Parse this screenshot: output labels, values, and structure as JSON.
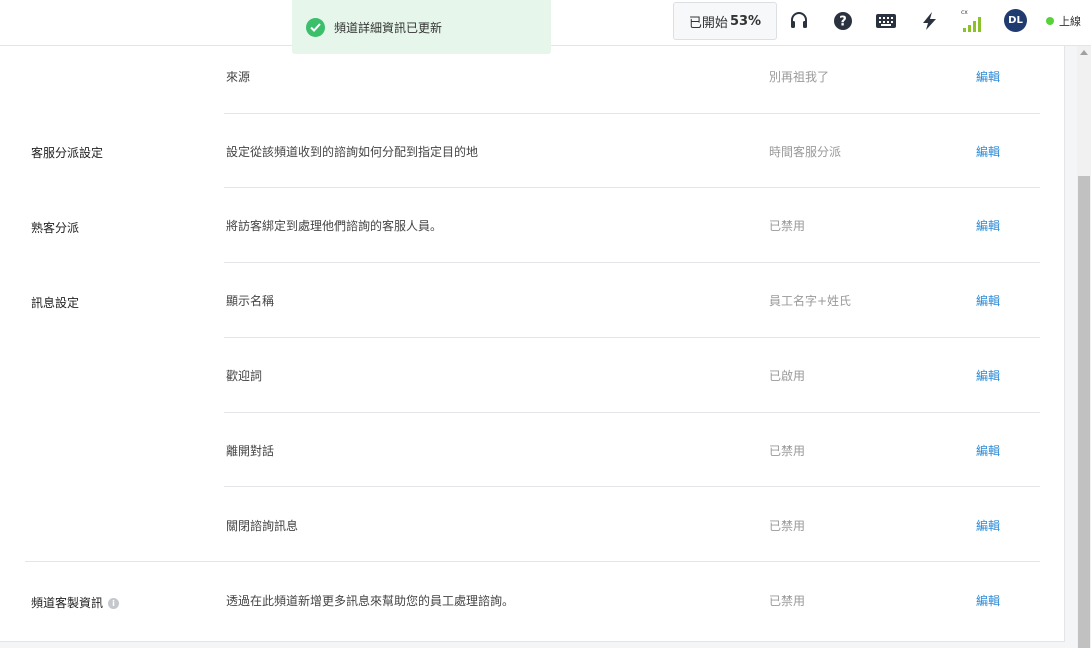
{
  "toast": {
    "message": "頻道詳細資訊已更新"
  },
  "topbar": {
    "trial_label": "已開始",
    "trial_percent": "53%",
    "signal_label": "cx",
    "avatar_initials": "DL",
    "status_label": "上線",
    "status_color": "#57d23a",
    "icons": [
      "headset-icon",
      "help-icon",
      "keyboard-icon",
      "lightning-icon",
      "signal-icon"
    ]
  },
  "settings": {
    "edit_label": "編輯",
    "rows": [
      {
        "section": "",
        "description": "來源",
        "value": "別再祖我了"
      },
      {
        "section": "客服分派設定",
        "description": "設定從該頻道收到的諮詢如何分配到指定目的地",
        "value": "時間客服分派"
      },
      {
        "section": "熟客分派",
        "description": "將訪客綁定到處理他們諮詢的客服人員。",
        "value": "已禁用"
      },
      {
        "section": "訊息設定",
        "description": "顯示名稱",
        "value": "員工名字+姓氏"
      },
      {
        "section": "",
        "description": "歡迎詞",
        "value": "已啟用"
      },
      {
        "section": "",
        "description": "離開對話",
        "value": "已禁用"
      },
      {
        "section": "",
        "description": "關閉諮詢訊息",
        "value": "已禁用"
      },
      {
        "section": "頻道客製資訊",
        "description": "透過在此頻道新增更多訊息來幫助您的員工處理諮詢。",
        "value": "已禁用"
      }
    ]
  },
  "colors": {
    "accent": "#2b8ad6",
    "toast_bg": "#e6f6ea",
    "success": "#3bbf6b",
    "avatar_bg": "#1f3b70"
  }
}
